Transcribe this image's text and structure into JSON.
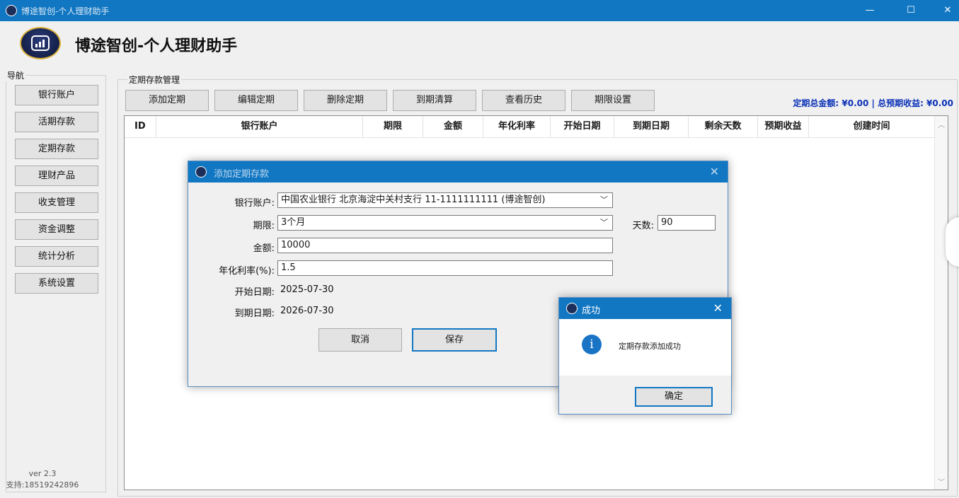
{
  "window": {
    "title": "博途智创-个人理财助手",
    "minimize": "—",
    "maximize": "☐",
    "close": "✕"
  },
  "header": {
    "app_title": "博途智创-个人理财助手"
  },
  "nav": {
    "group_label": "导航",
    "items": [
      {
        "label": "银行账户"
      },
      {
        "label": "活期存款"
      },
      {
        "label": "定期存款"
      },
      {
        "label": "理财产品"
      },
      {
        "label": "收支管理"
      },
      {
        "label": "资金调整"
      },
      {
        "label": "统计分析"
      },
      {
        "label": "系统设置"
      }
    ],
    "version": "ver 2.3",
    "support": "支持:18519242896"
  },
  "main": {
    "group_label": "定期存款管理",
    "toolbar": [
      {
        "label": "添加定期"
      },
      {
        "label": "编辑定期"
      },
      {
        "label": "删除定期"
      },
      {
        "label": "到期清算"
      },
      {
        "label": "查看历史"
      },
      {
        "label": "期限设置"
      }
    ],
    "summary": "定期总金额: ¥0.00 | 总预期收益: ¥0.00",
    "columns": [
      "ID",
      "银行账户",
      "期限",
      "金额",
      "年化利率",
      "开始日期",
      "到期日期",
      "剩余天数",
      "预期收益",
      "创建时间"
    ],
    "rows": []
  },
  "add_dialog": {
    "title": "添加定期存款",
    "close": "✕",
    "bank_label": "银行账户:",
    "bank_value": "中国农业银行 北京海淀中关村支行 11-1111111111 (博途智创)",
    "term_label": "期限:",
    "term_value": "3个月",
    "days_label": "天数:",
    "days_value": "90",
    "amount_label": "金额:",
    "amount_value": "10000",
    "rate_label": "年化利率(%):",
    "rate_value": "1.5",
    "start_label": "开始日期:",
    "start_value": "2025-07-30",
    "end_label": "到期日期:",
    "end_value": "2026-07-30",
    "cancel": "取消",
    "save": "保存"
  },
  "message_box": {
    "title": "成功",
    "close": "✕",
    "icon": "i",
    "message": "定期存款添加成功",
    "ok": "确定"
  },
  "colors": {
    "titlebar": "#1277c2",
    "summary_text": "#0b31b8"
  }
}
